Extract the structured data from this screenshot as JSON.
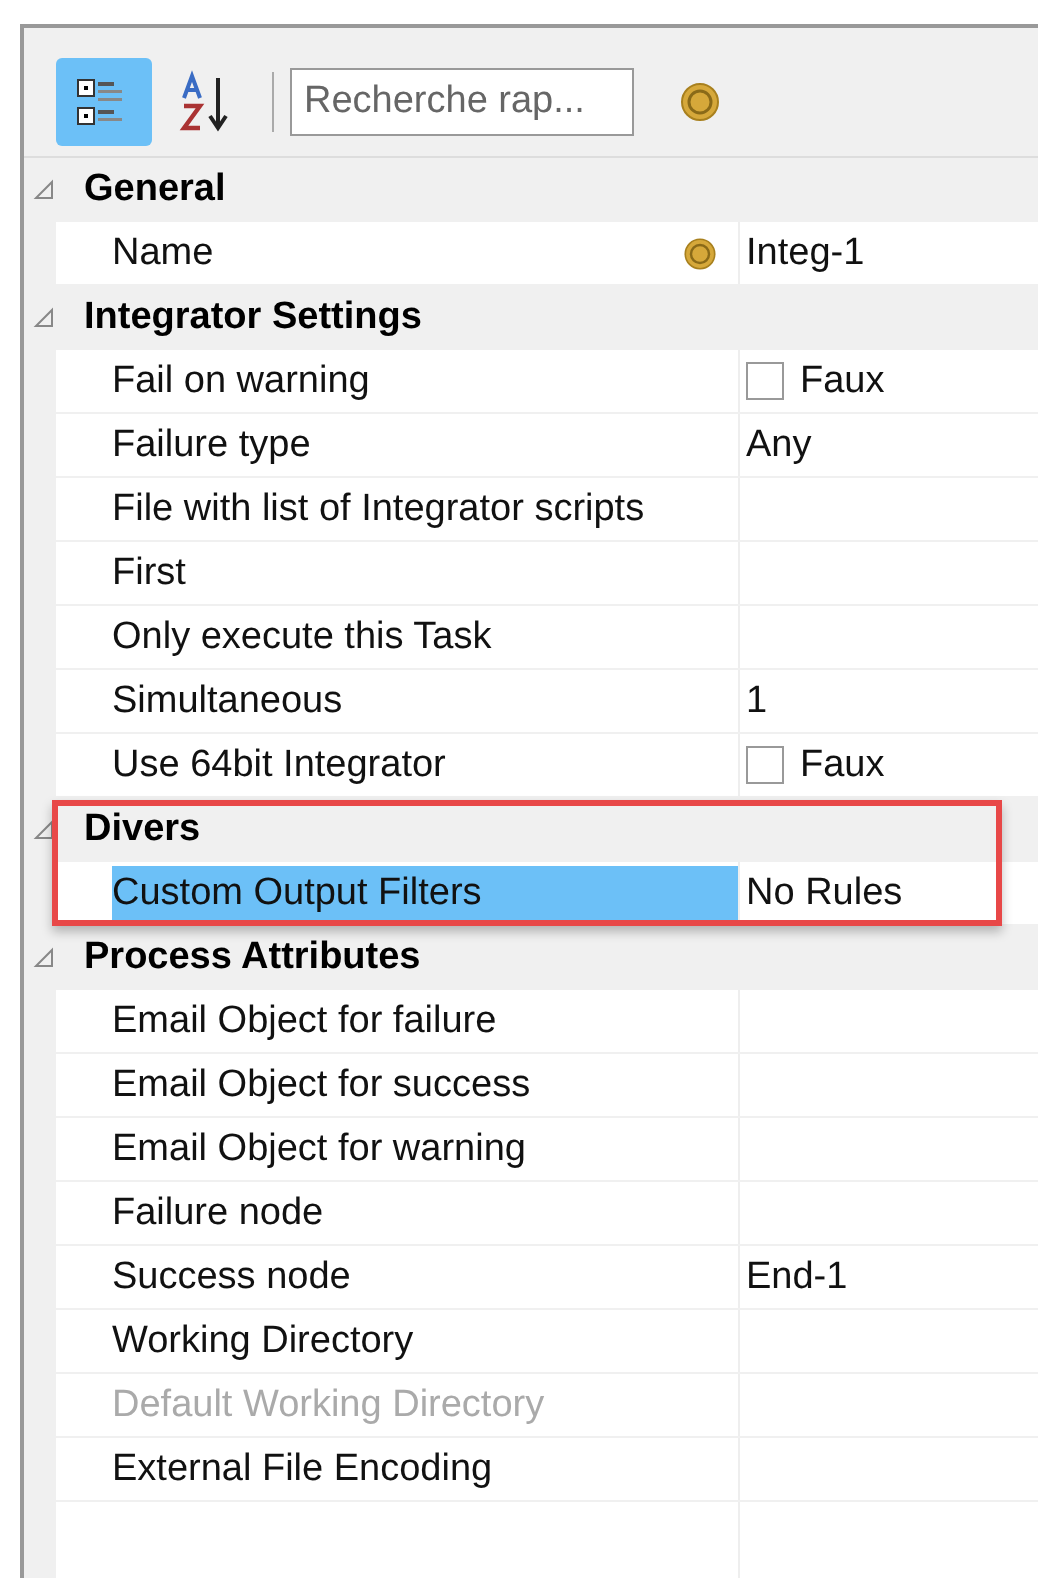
{
  "toolbar": {
    "buttons": [
      {
        "kind": "categorized",
        "selected": true
      },
      {
        "kind": "alphabetical",
        "selected": false
      }
    ],
    "search": {
      "placeholder": "Recherche rap..."
    }
  },
  "sections": [
    {
      "title": "General",
      "expanded": true,
      "rows": [
        {
          "name": "Name",
          "kind": "resource",
          "value": "Integ-1",
          "selected": false,
          "disabled": false
        }
      ]
    },
    {
      "title": "Integrator Settings",
      "expanded": true,
      "rows": [
        {
          "name": "Fail on warning",
          "kind": "checkbox",
          "value": "Faux",
          "checked": false,
          "selected": false,
          "disabled": false
        },
        {
          "name": "Failure type",
          "kind": "text",
          "value": "Any",
          "selected": false,
          "disabled": false
        },
        {
          "name": "File with list of Integrator scripts",
          "kind": "text",
          "selected": false,
          "disabled": false
        },
        {
          "name": "First",
          "kind": "text",
          "selected": false,
          "disabled": false
        },
        {
          "name": "Only execute this Task",
          "kind": "text",
          "selected": false,
          "disabled": false
        },
        {
          "name": "Simultaneous",
          "kind": "text",
          "value": "1",
          "selected": false,
          "disabled": false
        },
        {
          "name": "Use 64bit Integrator",
          "kind": "checkbox",
          "value": "Faux",
          "checked": false,
          "selected": false,
          "disabled": false
        }
      ]
    },
    {
      "title": "Divers",
      "expanded": true,
      "highlighted": true,
      "rows": [
        {
          "name": "Custom Output Filters",
          "kind": "text",
          "value": "No Rules",
          "selected": true,
          "disabled": false
        }
      ]
    },
    {
      "title": "Process Attributes",
      "expanded": true,
      "rows": [
        {
          "name": "Email Object for failure",
          "kind": "text",
          "selected": false,
          "disabled": false
        },
        {
          "name": "Email Object for success",
          "kind": "text",
          "selected": false,
          "disabled": false
        },
        {
          "name": "Email Object for warning",
          "kind": "text",
          "selected": false,
          "disabled": false
        },
        {
          "name": "Failure node",
          "kind": "text",
          "selected": false,
          "disabled": false
        },
        {
          "name": "Success node",
          "kind": "text",
          "value": "End-1",
          "selected": false,
          "disabled": false
        },
        {
          "name": "Working Directory",
          "kind": "text",
          "selected": false,
          "disabled": false
        },
        {
          "name": "Default Working Directory",
          "kind": "text",
          "selected": false,
          "disabled": true
        },
        {
          "name": "External File Encoding",
          "kind": "text",
          "selected": false,
          "disabled": false
        }
      ]
    }
  ]
}
